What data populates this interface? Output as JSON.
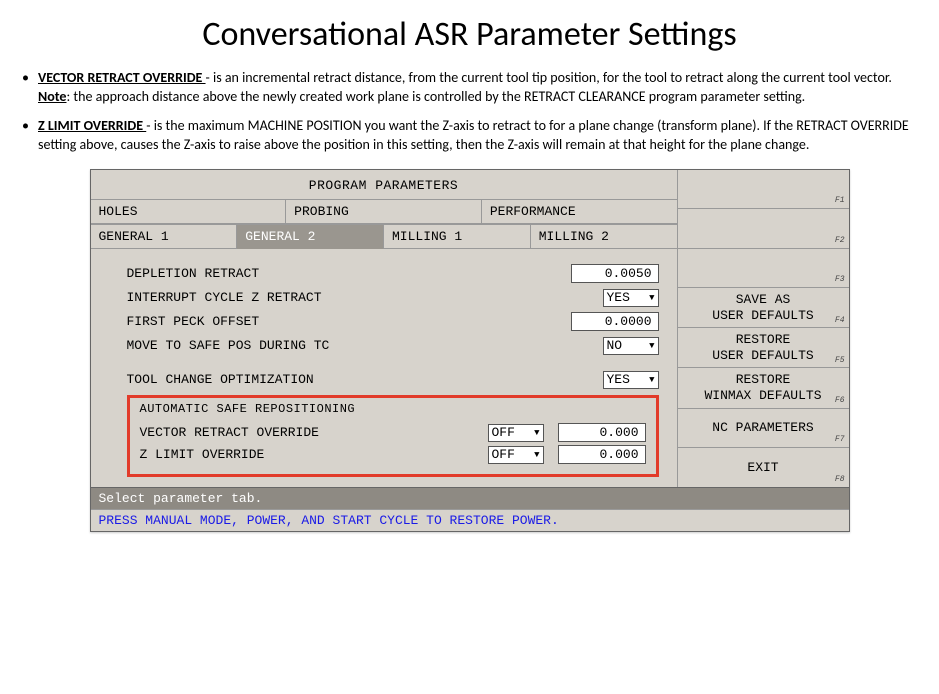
{
  "title": "Conversational ASR Parameter Settings",
  "bullets": [
    {
      "term": "VECTOR RETRACT OVERRIDE ",
      "dash": " - ",
      "body1": "is an incremental retract distance, from the current tool tip position, for the tool to retract along the current tool vector. ",
      "note_label": "Note",
      "body2": ": the approach distance above the newly created work plane is controlled by the RETRACT CLEARANCE program parameter setting."
    },
    {
      "term": "Z LIMIT OVERRIDE ",
      "dash": " - ",
      "body1": "is the maximum MACHINE POSITION you want the Z-axis to retract to for a plane change (transform plane). If the RETRACT OVERRIDE setting above, causes the Z-axis to raise above the position in this setting, then the Z-axis will remain at that height for the plane change.",
      "note_label": "",
      "body2": ""
    }
  ],
  "panel": {
    "header": "PROGRAM PARAMETERS",
    "tabs_row1": [
      "HOLES",
      "PROBING",
      "PERFORMANCE"
    ],
    "tabs_row2": [
      "GENERAL 1",
      "GENERAL 2",
      "MILLING 1",
      "MILLING 2"
    ],
    "active_tab": "GENERAL 2",
    "params": {
      "depletion_label": "DEPLETION RETRACT",
      "depletion_value": "0.0050",
      "interrupt_label": "INTERRUPT CYCLE Z RETRACT",
      "interrupt_value": "YES",
      "firstpeck_label": "FIRST PECK OFFSET",
      "firstpeck_value": "0.0000",
      "safepos_label": "MOVE TO SAFE POS DURING TC",
      "safepos_value": "NO",
      "toolchg_label": "TOOL CHANGE OPTIMIZATION",
      "toolchg_value": "YES"
    },
    "asr": {
      "legend": "AUTOMATIC SAFE REPOSITIONING",
      "vector_label": "VECTOR RETRACT OVERRIDE",
      "vector_sel": "OFF",
      "vector_val": "0.000",
      "zlimit_label": "Z LIMIT OVERRIDE",
      "zlimit_sel": "OFF",
      "zlimit_val": "0.000"
    },
    "fkeys": [
      {
        "label": "",
        "fk": "F1"
      },
      {
        "label": "",
        "fk": "F2"
      },
      {
        "label": "",
        "fk": "F3"
      },
      {
        "label": "SAVE AS\nUSER DEFAULTS",
        "fk": "F4"
      },
      {
        "label": "RESTORE\nUSER DEFAULTS",
        "fk": "F5"
      },
      {
        "label": "RESTORE\nWINMAX DEFAULTS",
        "fk": "F6"
      },
      {
        "label": "NC PARAMETERS",
        "fk": "F7"
      },
      {
        "label": "EXIT",
        "fk": "F8"
      }
    ],
    "status_grey": "Select parameter tab.",
    "status_blue": "PRESS MANUAL MODE, POWER, AND START CYCLE TO RESTORE POWER."
  }
}
